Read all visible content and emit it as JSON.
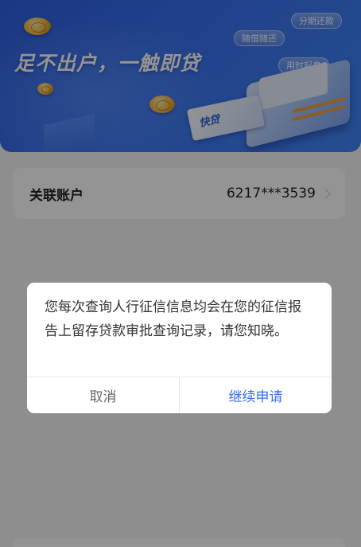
{
  "banner": {
    "headline": "足不出户，一触即贷",
    "tags": [
      "分期还款",
      "随借随还",
      "用时起息"
    ],
    "card_label": "快贷"
  },
  "account": {
    "label": "关联账户",
    "number": "6217***3539"
  },
  "dialog": {
    "message": "您每次查询人行征信信息均会在您的征信报告上留存贷款审批查询记录，请您知晓。",
    "cancel_label": "取消",
    "confirm_label": "继续申请"
  },
  "colors": {
    "banner_blue": "#3a72f0",
    "link_blue": "#3a6fe8",
    "coin_gold": "#f4b53a"
  },
  "icons": {
    "account_chevron": "chevron-right-icon"
  }
}
